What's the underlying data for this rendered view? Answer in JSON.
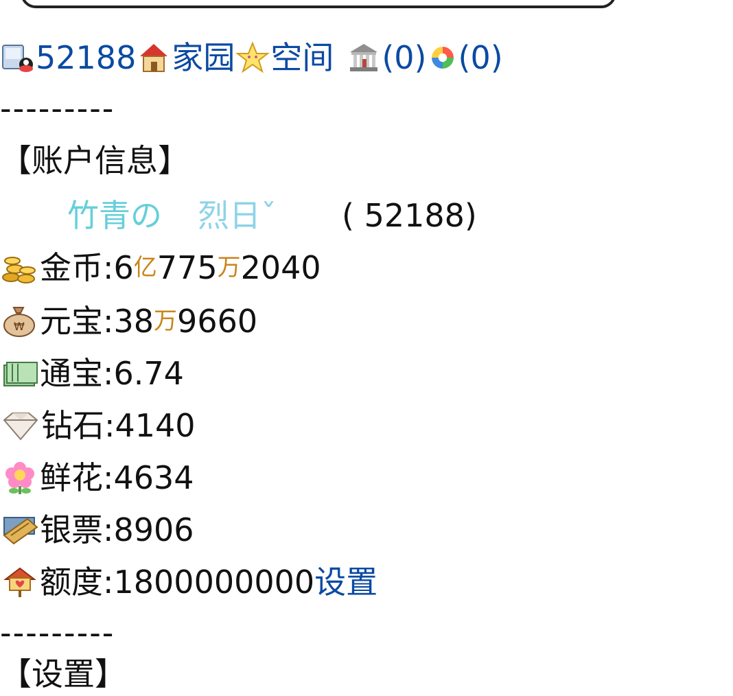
{
  "header": {
    "user_id": "52188",
    "home_label": "家园",
    "space_label": "空间",
    "bank_count": "(0)",
    "photo_count": "(0)"
  },
  "separator": "---------",
  "account": {
    "section_title": "【账户信息】",
    "name_part1": "竹青の",
    "name_part2": "烈日ˇ",
    "name_id": "( 52188)"
  },
  "assets": {
    "gold": {
      "label": "金币:",
      "v1": "6",
      "u1": "亿",
      "v2": "775",
      "u2": "万",
      "v3": "2040"
    },
    "yuanbao": {
      "label": "元宝:",
      "v1": "38",
      "u1": "万",
      "v2": "9660"
    },
    "tongbao": {
      "label": "通宝:",
      "value": "6.74"
    },
    "diamond": {
      "label": "钻石:",
      "value": "4140"
    },
    "flower": {
      "label": "鲜花:",
      "value": "4634"
    },
    "silver_note": {
      "label": "银票:",
      "value": "8906"
    },
    "quota": {
      "label": "额度:",
      "value": "1800000000",
      "set_link": "设置"
    }
  },
  "next_section": {
    "title": "【设置】"
  },
  "colors": {
    "link": "#0b4aa2",
    "unit": "#c9861a",
    "name": "#66cfd9"
  },
  "icons": [
    "qq-user-icon",
    "home-icon",
    "star-icon",
    "bank-icon",
    "photo-wheel-icon",
    "gold-coins-icon",
    "money-bag-icon",
    "banknotes-icon",
    "diamond-icon",
    "flower-icon",
    "silver-note-icon",
    "quota-sign-icon"
  ]
}
